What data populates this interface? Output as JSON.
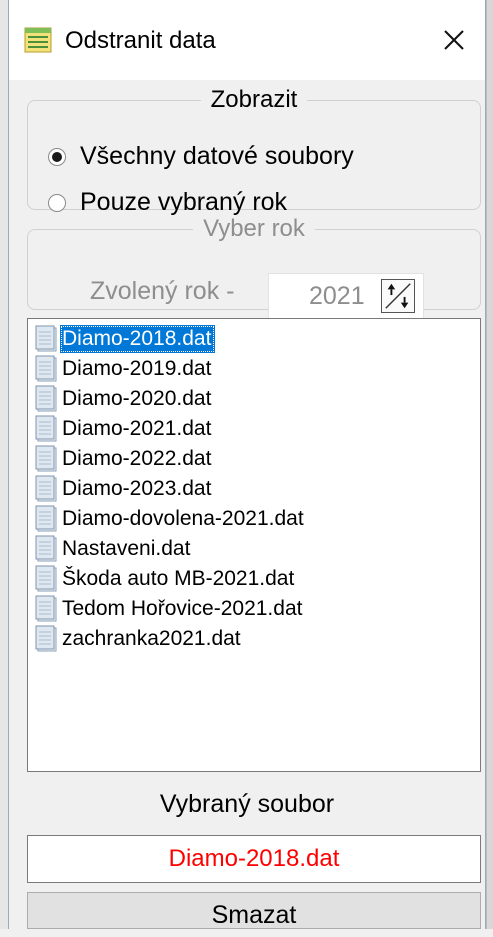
{
  "window": {
    "title": "Odstranit data"
  },
  "show_group": {
    "legend": "Zobrazit",
    "options": [
      {
        "label": "Všechny datové soubory",
        "checked": true
      },
      {
        "label": "Pouze vybraný rok",
        "checked": false
      }
    ]
  },
  "year_group": {
    "legend": "Vyber rok",
    "label": "Zvolený rok -",
    "value": "2021"
  },
  "files": [
    "Diamo-2018.dat",
    "Diamo-2019.dat",
    "Diamo-2020.dat",
    "Diamo-2021.dat",
    "Diamo-2022.dat",
    "Diamo-2023.dat",
    "Diamo-dovolena-2021.dat",
    "Nastaveni.dat",
    "Škoda auto MB-2021.dat",
    "Tedom Hořovice-2021.dat",
    "zachranka2021.dat"
  ],
  "selected_index": 0,
  "selected_file": {
    "label": "Vybraný soubor",
    "value": "Diamo-2018.dat"
  },
  "actions": {
    "delete_label": "Smazat"
  },
  "colors": {
    "selection": "#0078d7",
    "selected_value": "#ff0000"
  }
}
